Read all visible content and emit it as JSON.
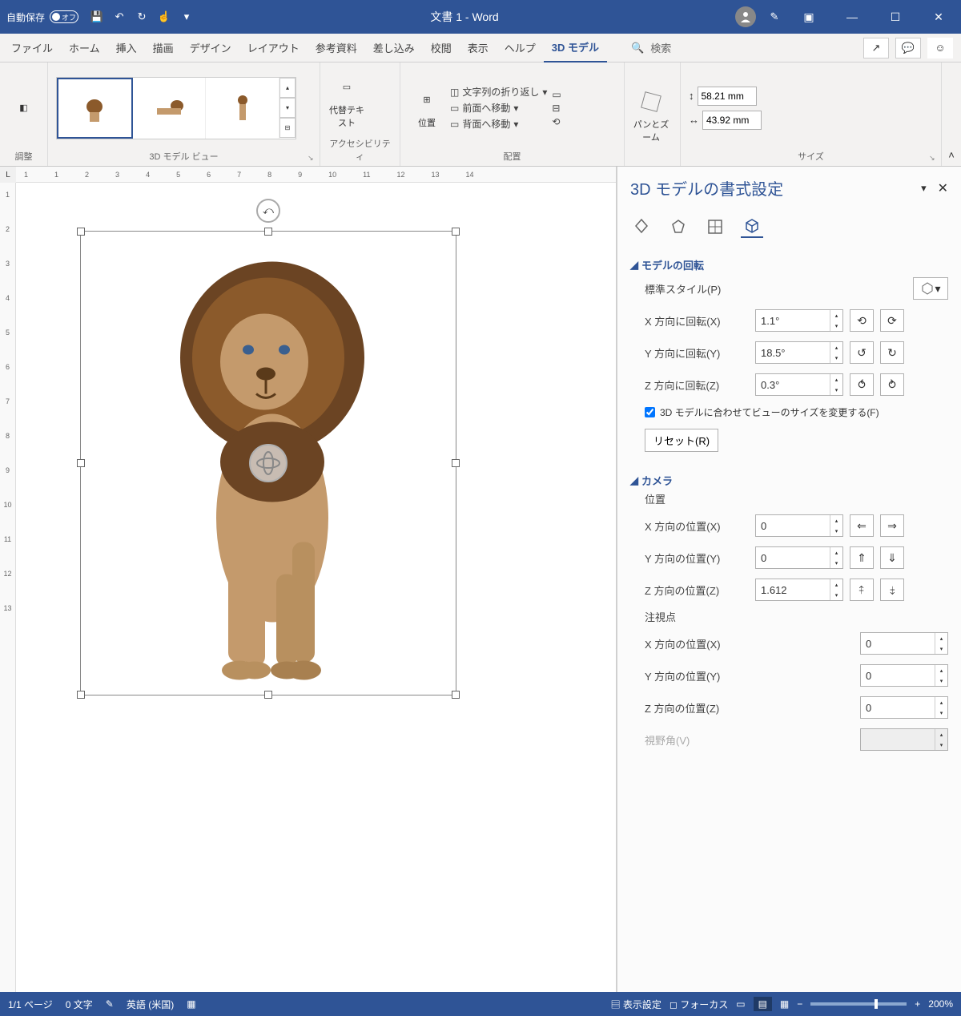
{
  "titlebar": {
    "autosave_label": "自動保存",
    "autosave_state": "オフ",
    "doc_title": "文書 1 - Word"
  },
  "tabs": [
    "ファイル",
    "ホーム",
    "挿入",
    "描画",
    "デザイン",
    "レイアウト",
    "参考資料",
    "差し込み",
    "校閲",
    "表示",
    "ヘルプ",
    "3D モデル"
  ],
  "active_tab": "3D モデル",
  "search_label": "検索",
  "ribbon": {
    "adjust_label": "調整",
    "views_label": "3D モデル ビュー",
    "alt_text_label": "代替テキスト",
    "accessibility_label": "アクセシビリティ",
    "position_label": "位置",
    "arrange": {
      "wrap_label": "文字列の折り返し",
      "forward_label": "前面へ移動",
      "backward_label": "背面へ移動",
      "group_label": "配置"
    },
    "pan_zoom_label": "パンとズーム",
    "size": {
      "height": "58.21 mm",
      "width": "43.92 mm",
      "group_label": "サイズ"
    }
  },
  "ruler_h": [
    "1",
    "",
    "1",
    "",
    "2",
    "",
    "3",
    "",
    "4",
    "",
    "5",
    "",
    "6",
    "",
    "7",
    "",
    "8",
    "",
    "9",
    "",
    "10",
    "",
    "11",
    "",
    "12",
    "",
    "13",
    "",
    "14"
  ],
  "ruler_v": [
    "",
    "",
    "1",
    "",
    "2",
    "",
    "3",
    "",
    "4",
    "",
    "5",
    "",
    "6",
    "",
    "7",
    "",
    "8",
    "",
    "9",
    "",
    "10",
    "",
    "11",
    "",
    "12",
    "",
    "13"
  ],
  "pane": {
    "title": "3D モデルの書式設定",
    "rotation_section": "モデルの回転",
    "preset_label": "標準スタイル(P)",
    "x_rot_label": "X 方向に回転(X)",
    "x_rot_value": "1.1°",
    "y_rot_label": "Y 方向に回転(Y)",
    "y_rot_value": "18.5°",
    "z_rot_label": "Z 方向に回転(Z)",
    "z_rot_value": "0.3°",
    "fit_checkbox": "3D モデルに合わせてビューのサイズを変更する(F)",
    "reset_label": "リセット(R)",
    "camera_section": "カメラ",
    "position_label": "位置",
    "x_pos_label": "X 方向の位置(X)",
    "x_pos_value": "0",
    "y_pos_label": "Y 方向の位置(Y)",
    "y_pos_value": "0",
    "z_pos_label": "Z 方向の位置(Z)",
    "z_pos_value": "1.612",
    "look_at_label": "注視点",
    "look_x_label": "X 方向の位置(X)",
    "look_x_value": "0",
    "look_y_label": "Y 方向の位置(Y)",
    "look_y_value": "0",
    "look_z_label": "Z 方向の位置(Z)",
    "look_z_value": "0",
    "fov_label": "視野角(V)"
  },
  "statusbar": {
    "page": "1/1 ページ",
    "words": "0 文字",
    "lang": "英語 (米国)",
    "display_settings": "表示設定",
    "focus": "フォーカス",
    "zoom": "200%"
  }
}
